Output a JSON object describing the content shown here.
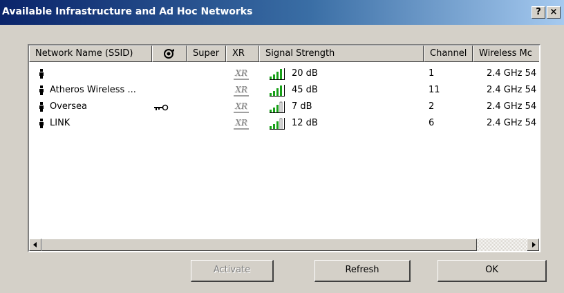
{
  "window": {
    "title": "Available Infrastructure and Ad Hoc Networks",
    "help_label": "?",
    "close_label": "×"
  },
  "table": {
    "columns": [
      "Network Name (SSID)",
      "",
      "Super",
      "XR",
      "Signal Strength",
      "Channel",
      "Wireless Mc"
    ],
    "rows": [
      {
        "name": "",
        "secured": false,
        "xr": "XR",
        "signal": "20 dB",
        "channel": "1",
        "mode": "2.4 GHz 54"
      },
      {
        "name": "Atheros Wireless ...",
        "secured": false,
        "xr": "XR",
        "signal": "45 dB",
        "channel": "11",
        "mode": "2.4 GHz 54"
      },
      {
        "name": "Oversea",
        "secured": true,
        "xr": "XR",
        "signal": "7 dB",
        "channel": "2",
        "mode": "2.4 GHz 54"
      },
      {
        "name": "LINK",
        "secured": false,
        "xr": "XR",
        "signal": "12 dB",
        "channel": "6",
        "mode": "2.4 GHz 54"
      }
    ]
  },
  "buttons": {
    "activate": "Activate",
    "activate_enabled": false,
    "refresh": "Refresh",
    "ok": "OK"
  },
  "colors": {
    "title_gradient_start": "#0a246a",
    "title_gradient_end": "#a6caf0",
    "dialog_face": "#d4d0c8",
    "signal_bars": "#18a018"
  },
  "icons": {
    "network": "ad-hoc-person-icon",
    "security": "key-icon",
    "xr": "xr-icon",
    "signal": "signal-bars-icon",
    "encryption_header": "encryption-icon"
  }
}
